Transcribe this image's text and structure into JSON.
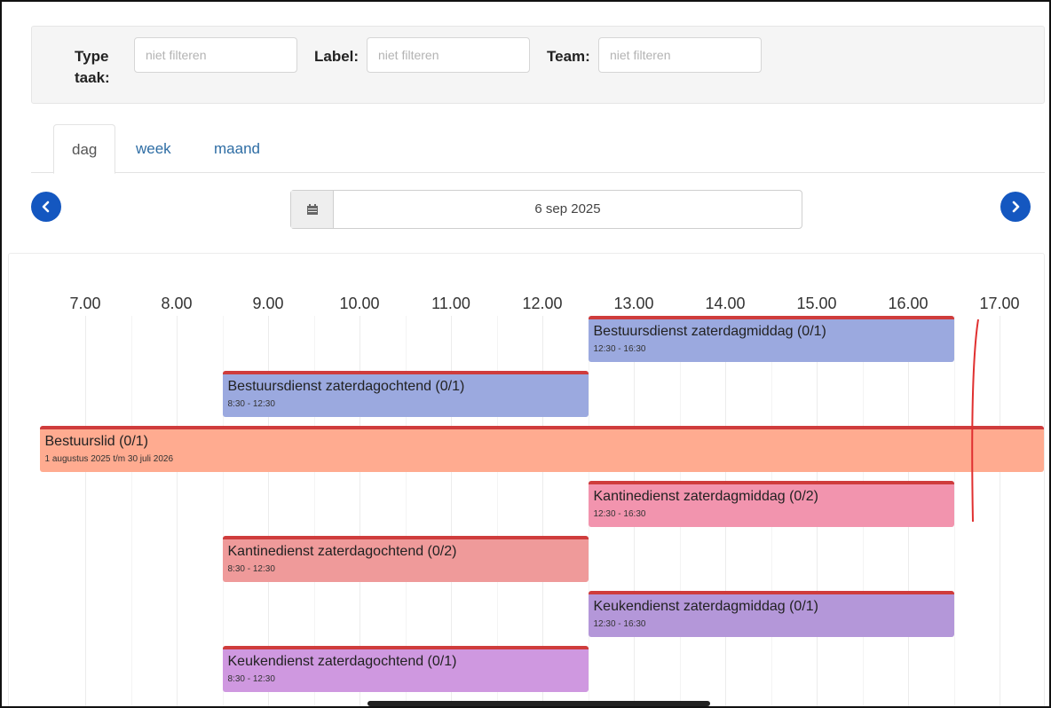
{
  "filters": {
    "type_label": "Type taak:",
    "type_placeholder": "niet filteren",
    "label_label": "Label:",
    "label_placeholder": "niet filteren",
    "team_label": "Team:",
    "team_placeholder": "niet filteren"
  },
  "tabs": [
    {
      "label": "dag",
      "active": true
    },
    {
      "label": "week",
      "active": false
    },
    {
      "label": "maand",
      "active": false
    }
  ],
  "date_nav": {
    "date": "6 sep 2025",
    "prev_icon": "chevron-left-icon",
    "next_icon": "chevron-right-icon",
    "calendar_icon": "calendar-icon"
  },
  "timeline": {
    "hours": [
      "7.00",
      "8.00",
      "9.00",
      "10.00",
      "11.00",
      "12.00",
      "13.00",
      "14.00",
      "15.00",
      "16.00",
      "17.00"
    ],
    "events": [
      {
        "title": "Bestuursdienst zaterdagmiddag (0/1)",
        "time": "12:30 - 16:30",
        "start": 12.5,
        "end": 16.5,
        "color": "#9ba9df"
      },
      {
        "title": "Bestuursdienst zaterdagochtend (0/1)",
        "time": "8:30 - 12:30",
        "start": 8.5,
        "end": 12.5,
        "color": "#9ba9df"
      },
      {
        "title": "Bestuurslid (0/1)",
        "time": "1 augustus 2025 t/m 30 juli 2026",
        "start": 6.5,
        "end": 17.5,
        "color": "#ffab90"
      },
      {
        "title": "Kantinedienst zaterdagmiddag (0/2)",
        "time": "12:30 - 16:30",
        "start": 12.5,
        "end": 16.5,
        "color": "#f294ae"
      },
      {
        "title": "Kantinedienst zaterdagochtend (0/2)",
        "time": "8:30 - 12:30",
        "start": 8.5,
        "end": 12.5,
        "color": "#ef9a9a"
      },
      {
        "title": "Keukendienst zaterdagmiddag (0/1)",
        "time": "12:30 - 16:30",
        "start": 12.5,
        "end": 16.5,
        "color": "#b497d9"
      },
      {
        "title": "Keukendienst zaterdagochtend (0/1)",
        "time": "8:30 - 12:30",
        "start": 8.5,
        "end": 12.5,
        "color": "#cf98e0"
      }
    ],
    "accent": "#cf3c3c",
    "nav_color": "#1457c0"
  }
}
